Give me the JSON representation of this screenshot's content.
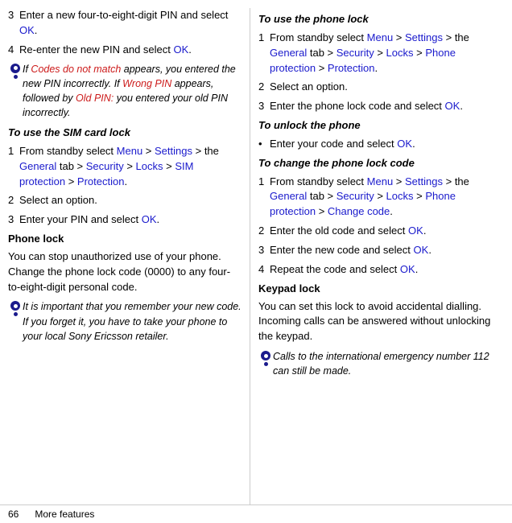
{
  "footer": {
    "page_num": "66",
    "section": "More features"
  },
  "left": {
    "items": [
      {
        "type": "step",
        "num": "3",
        "text_parts": [
          {
            "text": "Enter a new four-to-eight-digit PIN and select "
          },
          {
            "text": "OK",
            "style": "link-blue"
          },
          {
            "text": "."
          }
        ]
      },
      {
        "type": "step",
        "num": "4",
        "text_parts": [
          {
            "text": "Re-enter the new PIN and select "
          },
          {
            "text": "OK",
            "style": "link-blue"
          },
          {
            "text": "."
          }
        ]
      },
      {
        "type": "note",
        "text_parts": [
          {
            "text": "If "
          },
          {
            "text": "Codes do not match",
            "style": "link-red"
          },
          {
            "text": " appears, you entered the new PIN incorrectly. If "
          },
          {
            "text": "Wrong PIN",
            "style": "link-red"
          },
          {
            "text": " appears, followed by "
          },
          {
            "text": "Old PIN:",
            "style": "link-red"
          },
          {
            "text": " you entered your old PIN incorrectly."
          }
        ]
      },
      {
        "type": "sub-heading",
        "text": "To use the SIM card lock"
      },
      {
        "type": "step",
        "num": "1",
        "text_parts": [
          {
            "text": "From standby select "
          },
          {
            "text": "Menu",
            "style": "link-blue"
          },
          {
            "text": " > "
          },
          {
            "text": "Settings",
            "style": "link-blue"
          },
          {
            "text": " > the "
          },
          {
            "text": "General",
            "style": "link-blue"
          },
          {
            "text": " tab > "
          },
          {
            "text": "Security",
            "style": "link-blue"
          },
          {
            "text": " > "
          },
          {
            "text": "Locks",
            "style": "link-blue"
          },
          {
            "text": " > "
          },
          {
            "text": "SIM protection",
            "style": "link-blue"
          },
          {
            "text": " > "
          },
          {
            "text": "Protection",
            "style": "link-blue"
          },
          {
            "text": "."
          }
        ]
      },
      {
        "type": "step",
        "num": "2",
        "text": "Select an option."
      },
      {
        "type": "step",
        "num": "3",
        "text_parts": [
          {
            "text": "Enter your PIN and select "
          },
          {
            "text": "OK",
            "style": "link-blue"
          },
          {
            "text": "."
          }
        ]
      },
      {
        "type": "section-heading",
        "text": "Phone lock"
      },
      {
        "type": "paragraph",
        "text": "You can stop unauthorized use of your phone. Change the phone lock code (0000) to any four-to-eight-digit personal code."
      },
      {
        "type": "note",
        "text_parts": [
          {
            "text": "It is important that you remember your new code. If you forget it, you have to take your phone to your local Sony Ericsson retailer."
          }
        ]
      }
    ]
  },
  "right": {
    "items": [
      {
        "type": "sub-heading",
        "text": "To use the phone lock"
      },
      {
        "type": "step",
        "num": "1",
        "text_parts": [
          {
            "text": "From standby select "
          },
          {
            "text": "Menu",
            "style": "link-blue"
          },
          {
            "text": " > "
          },
          {
            "text": "Settings",
            "style": "link-blue"
          },
          {
            "text": " > the "
          },
          {
            "text": "General",
            "style": "link-blue"
          },
          {
            "text": " tab > "
          },
          {
            "text": "Security",
            "style": "link-blue"
          },
          {
            "text": " > "
          },
          {
            "text": "Locks",
            "style": "link-blue"
          },
          {
            "text": " > "
          },
          {
            "text": "Phone protection",
            "style": "link-blue"
          },
          {
            "text": " > "
          },
          {
            "text": "Protection",
            "style": "link-blue"
          },
          {
            "text": "."
          }
        ]
      },
      {
        "type": "step",
        "num": "2",
        "text": "Select an option."
      },
      {
        "type": "step",
        "num": "3",
        "text_parts": [
          {
            "text": "Enter the phone lock code and select "
          },
          {
            "text": "OK",
            "style": "link-blue"
          },
          {
            "text": "."
          }
        ]
      },
      {
        "type": "sub-heading",
        "text": "To unlock the phone"
      },
      {
        "type": "bullet",
        "text_parts": [
          {
            "text": "Enter your code and select "
          },
          {
            "text": "OK",
            "style": "link-blue"
          },
          {
            "text": "."
          }
        ]
      },
      {
        "type": "sub-heading",
        "text": "To change the phone lock code"
      },
      {
        "type": "step",
        "num": "1",
        "text_parts": [
          {
            "text": "From standby select "
          },
          {
            "text": "Menu",
            "style": "link-blue"
          },
          {
            "text": " > "
          },
          {
            "text": "Settings",
            "style": "link-blue"
          },
          {
            "text": " > the "
          },
          {
            "text": "General",
            "style": "link-blue"
          },
          {
            "text": " tab > "
          },
          {
            "text": "Security",
            "style": "link-blue"
          },
          {
            "text": " > "
          },
          {
            "text": "Locks",
            "style": "link-blue"
          },
          {
            "text": " > "
          },
          {
            "text": "Phone protection",
            "style": "link-blue"
          },
          {
            "text": " > "
          },
          {
            "text": "Change code",
            "style": "link-blue"
          },
          {
            "text": "."
          }
        ]
      },
      {
        "type": "step",
        "num": "2",
        "text_parts": [
          {
            "text": "Enter the old code and select "
          },
          {
            "text": "OK",
            "style": "link-blue"
          },
          {
            "text": "."
          }
        ]
      },
      {
        "type": "step",
        "num": "3",
        "text_parts": [
          {
            "text": "Enter the new code and select "
          },
          {
            "text": "OK",
            "style": "link-blue"
          },
          {
            "text": "."
          }
        ]
      },
      {
        "type": "step",
        "num": "4",
        "text_parts": [
          {
            "text": "Repeat the code and select "
          },
          {
            "text": "OK",
            "style": "link-blue"
          },
          {
            "text": "."
          }
        ]
      },
      {
        "type": "section-heading",
        "text": "Keypad lock"
      },
      {
        "type": "paragraph",
        "text": "You can set this lock to avoid accidental dialling. Incoming calls can be answered without unlocking the keypad."
      },
      {
        "type": "note",
        "text_parts": [
          {
            "text": "Calls to the international emergency number 112 can still be made."
          }
        ]
      }
    ]
  }
}
